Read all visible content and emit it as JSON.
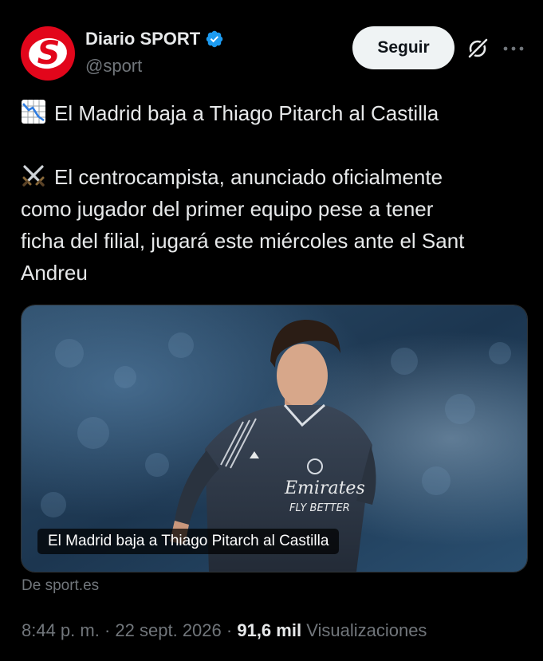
{
  "author": {
    "display_name": "Diario SPORT",
    "handle": "@sport",
    "avatar_letter": "S",
    "avatar_color": "#e2061b",
    "verified_badge": "verified-badge-icon"
  },
  "actions": {
    "follow_label": "Seguir",
    "grok_icon": "grok-icon",
    "more_icon": "more-options-icon"
  },
  "text": {
    "line1_emoji": "chart-decreasing-icon",
    "line1": "El Madrid baja a Thiago Pitarch al Castilla",
    "para2_emoji": "crossed-swords-icon",
    "para2_lines": [
      "El centrocampista, anunciado oficialmente",
      "como jugador del primer equipo pese a tener",
      "ficha del filial, jugará este miércoles ante el Sant",
      "Andreu"
    ]
  },
  "card": {
    "title": "El Madrid baja a Thiago Pitarch al Castilla",
    "image": "player-photo",
    "jersey_sponsor_line1": "Emirates",
    "jersey_sponsor_line2": "FLY BETTER",
    "source": "De sport.es"
  },
  "meta": {
    "time": "8:44 p. m.",
    "separator": "·",
    "date": "22 sept. 2026",
    "views_count": "91,6 mil",
    "views_label": "Visualizaciones"
  },
  "colors": {
    "background": "#000000",
    "primary_text": "#e7e9ea",
    "secondary_text": "#71767b",
    "verified_blue": "#1d9bf0",
    "button_bg": "#eff3f4"
  }
}
